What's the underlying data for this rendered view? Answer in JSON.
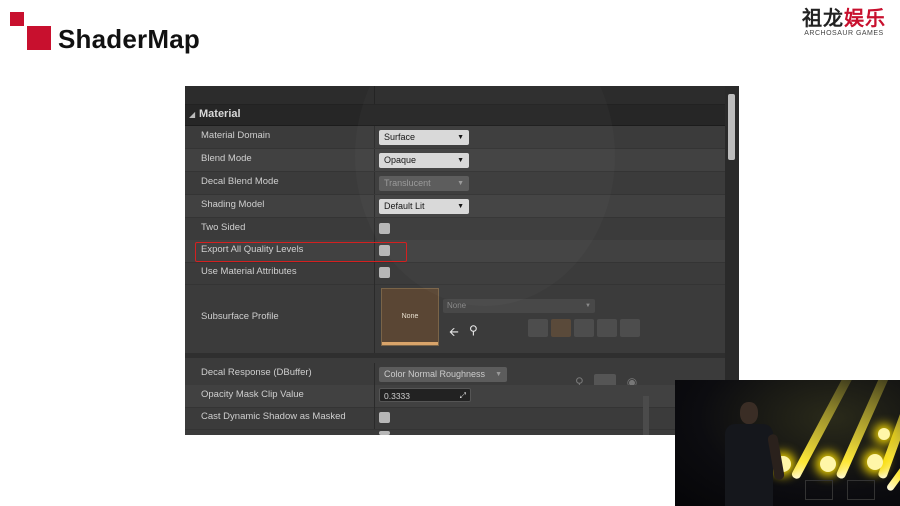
{
  "colors": {
    "brand_red": "#c8102e",
    "panel_bg": "#3b3b3b",
    "highlight_red": "#d42020",
    "beam_yellow": "#ffe93a"
  },
  "slide": {
    "title": "ShaderMap",
    "brand_cn_main": "祖龙",
    "brand_cn_accent": "娱乐",
    "brand_en": "ARCHOSAUR GAMES"
  },
  "panel": {
    "section_label": "Material",
    "section_icon": "triangle-collapse-icon",
    "rows": [
      {
        "label": "Material Domain",
        "value": "Surface"
      },
      {
        "label": "Blend Mode",
        "value": "Opaque"
      },
      {
        "label": "Decal Blend Mode",
        "value": "Translucent"
      },
      {
        "label": "Shading Model",
        "value": "Default Lit"
      },
      {
        "label": "Two Sided"
      },
      {
        "label": "Export All Quality Levels"
      },
      {
        "label": "Use Material Attributes"
      },
      {
        "label": "Subsurface Profile",
        "thumb": "None",
        "select": "None"
      },
      {
        "label": "Decal Response (DBuffer)",
        "value": "Color Normal Roughness"
      },
      {
        "label": "Opacity Mask Clip Value",
        "value": "0.3333"
      },
      {
        "label": "Cast Dynamic Shadow as Masked"
      }
    ],
    "arrow_icon": "dropdown-arrow-icon",
    "use_asset_icon": "arrow-left-icon",
    "browse_icon": "magnifier-icon"
  }
}
